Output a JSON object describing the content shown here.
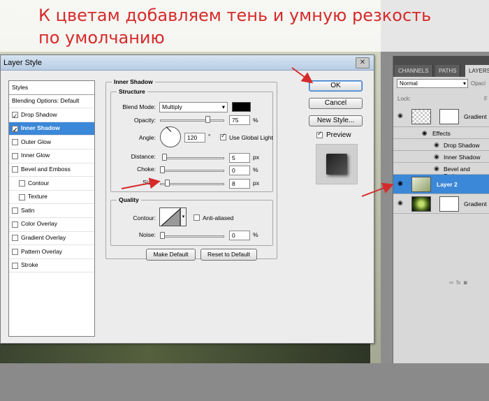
{
  "caption": {
    "line1": "К цветам добавляем тень и умную резкость",
    "line2": "по умолчанию"
  },
  "dialog": {
    "title": "Layer Style",
    "close_label": "✕",
    "styles_list": {
      "header": "Styles",
      "blending": "Blending Options: Default",
      "items": [
        {
          "label": "Drop Shadow",
          "checked": true
        },
        {
          "label": "Inner Shadow",
          "checked": true,
          "selected": true
        },
        {
          "label": "Outer Glow",
          "checked": false
        },
        {
          "label": "Inner Glow",
          "checked": false
        },
        {
          "label": "Bevel and Emboss",
          "checked": false
        },
        {
          "label": "Contour",
          "checked": false,
          "indent": true
        },
        {
          "label": "Texture",
          "checked": false,
          "indent": true
        },
        {
          "label": "Satin",
          "checked": false
        },
        {
          "label": "Color Overlay",
          "checked": false
        },
        {
          "label": "Gradient Overlay",
          "checked": false
        },
        {
          "label": "Pattern Overlay",
          "checked": false
        },
        {
          "label": "Stroke",
          "checked": false
        }
      ]
    },
    "inner_shadow": {
      "title": "Inner Shadow",
      "structure_title": "Structure",
      "blend_mode_label": "Blend Mode:",
      "blend_mode_value": "Multiply",
      "shadow_color": "#000000",
      "opacity_label": "Opacity:",
      "opacity_value": "75",
      "angle_label": "Angle:",
      "angle_value": "120",
      "angle_unit": "°",
      "use_global_light_label": "Use Global Light",
      "distance_label": "Distance:",
      "distance_value": "5",
      "choke_label": "Choke:",
      "choke_value": "0",
      "size_label": "Size:",
      "size_value": "8",
      "px": "px",
      "pct": "%",
      "quality_title": "Quality",
      "contour_label": "Contour:",
      "anti_aliased_label": "Anti-aliased",
      "noise_label": "Noise:",
      "noise_value": "0",
      "make_default_label": "Make Default",
      "reset_default_label": "Reset to Default"
    },
    "buttons": {
      "ok": "OK",
      "cancel": "Cancel",
      "new_style": "New Style...",
      "preview": "Preview"
    }
  },
  "layers_panel": {
    "tabs": [
      "CHANNELS",
      "PATHS",
      "LAYERS"
    ],
    "blend_mode": "Normal",
    "opacity_label": "Opaci",
    "lock_label": "Lock:",
    "fill_label": "F",
    "layers": [
      {
        "name": "Gradient",
        "type": "gradient-top"
      },
      {
        "name": "Effects",
        "type": "effects-header"
      },
      {
        "name": "Drop Shadow",
        "type": "effect"
      },
      {
        "name": "Inner Shadow",
        "type": "effect"
      },
      {
        "name": "Bevel and Emboss",
        "type": "effect"
      },
      {
        "name": "Layer 2",
        "type": "selected"
      },
      {
        "name": "Gradient",
        "type": "gradient-bottom"
      }
    ]
  },
  "colors": {
    "selection_blue": "#3b87d8",
    "annotation_red": "#d62a2a"
  }
}
